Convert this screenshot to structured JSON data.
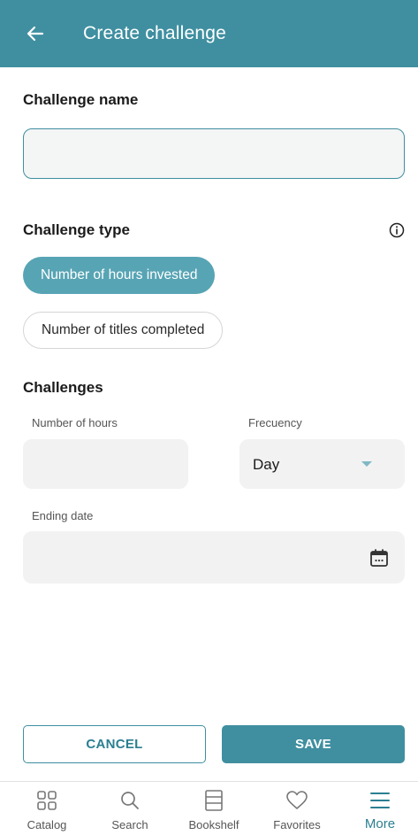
{
  "header": {
    "title": "Create challenge",
    "back_icon": "arrow-left-icon"
  },
  "challenge_name": {
    "label": "Challenge name",
    "value": ""
  },
  "challenge_type": {
    "label": "Challenge type",
    "info_icon": "info-icon",
    "options": [
      {
        "label": "Number of hours invested",
        "selected": true
      },
      {
        "label": "Number of titles completed",
        "selected": false
      }
    ]
  },
  "challenges": {
    "label": "Challenges",
    "hours_label": "Number of hours",
    "hours_value": "",
    "frequency_label": "Frecuency",
    "frequency_value": "Day",
    "ending_date_label": "Ending date",
    "ending_date_value": "",
    "calendar_icon": "calendar-icon"
  },
  "actions": {
    "cancel_label": "CANCEL",
    "save_label": "SAVE"
  },
  "bottom_nav": {
    "items": [
      {
        "label": "Catalog",
        "icon": "grid-icon",
        "active": false
      },
      {
        "label": "Search",
        "icon": "search-icon",
        "active": false
      },
      {
        "label": "Bookshelf",
        "icon": "bookshelf-icon",
        "active": false
      },
      {
        "label": "Favorites",
        "icon": "heart-icon",
        "active": false
      },
      {
        "label": "More",
        "icon": "menu-icon",
        "active": true
      }
    ]
  },
  "colors": {
    "primary": "#3f8fa0",
    "chip_active": "#57a4b4",
    "field_bg": "#f2f2f2"
  }
}
